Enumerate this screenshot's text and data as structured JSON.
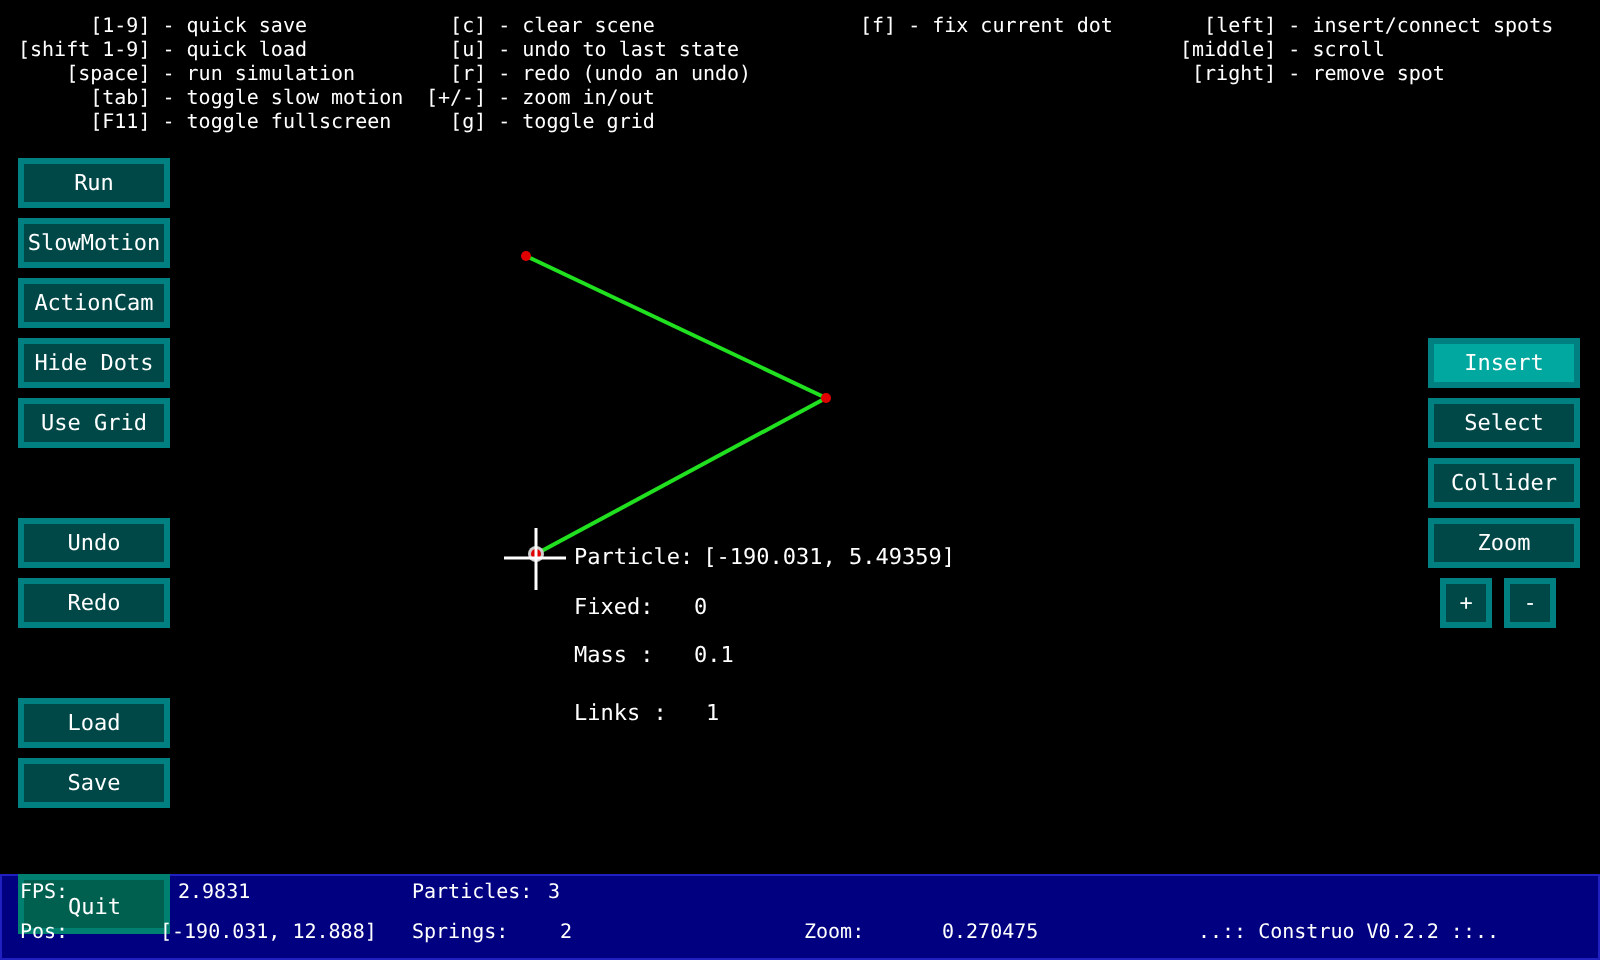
{
  "help_columns": [
    [
      {
        "key": "[1-9]",
        "action": "- quick save"
      },
      {
        "key": "[shift 1-9]",
        "action": "- quick load"
      },
      {
        "key": "[space]",
        "action": "- run simulation"
      },
      {
        "key": "[tab]",
        "action": "- toggle slow motion"
      },
      {
        "key": "[F11]",
        "action": "- toggle fullscreen"
      }
    ],
    [
      {
        "key": "[c]",
        "action": "- clear scene"
      },
      {
        "key": "[u]",
        "action": "- undo to last state"
      },
      {
        "key": "[r]",
        "action": "- redo (undo an undo)"
      },
      {
        "key": "[+/-]",
        "action": "- zoom in/out"
      },
      {
        "key": "[g]",
        "action": "- toggle grid"
      }
    ],
    [
      {
        "key": "[f]",
        "action": "- fix current dot"
      }
    ],
    [
      {
        "key": "[left]",
        "action": "- insert/connect spots"
      },
      {
        "key": "[middle]",
        "action": "- scroll"
      },
      {
        "key": "[right]",
        "action": "- remove spot"
      }
    ]
  ],
  "left_button_groups": [
    [
      "Run",
      "SlowMotion",
      "ActionCam",
      "Hide Dots",
      "Use Grid"
    ],
    [
      "Undo",
      "Redo"
    ],
    [
      "Load",
      "Save"
    ]
  ],
  "modes": [
    {
      "label": "Insert",
      "selected": true
    },
    {
      "label": "Select",
      "selected": false
    },
    {
      "label": "Collider",
      "selected": false
    },
    {
      "label": "Zoom",
      "selected": false
    }
  ],
  "zoom_buttons": [
    "+",
    "-"
  ],
  "particle_info": {
    "particle_label": "Particle:",
    "particle_value": "[-190.031, 5.49359]",
    "rows": [
      {
        "label": "Fixed:",
        "value": "0"
      },
      {
        "label": "Mass :",
        "value": "0.1"
      },
      {
        "label": "Links :",
        "value": "1"
      }
    ]
  },
  "quit_button": "Quit",
  "status_bar": {
    "fps_label": "FPS:",
    "fps": "2.9831",
    "pos_label": "Pos:",
    "pos": "[-190.031, 12.888]",
    "particles_label": "Particles:",
    "particles": "3",
    "springs_label": "Springs:",
    "springs": "2",
    "zoom_label": "Zoom:",
    "zoom": "0.270475",
    "title": "..:: Construo V0.2.2 ::.."
  }
}
